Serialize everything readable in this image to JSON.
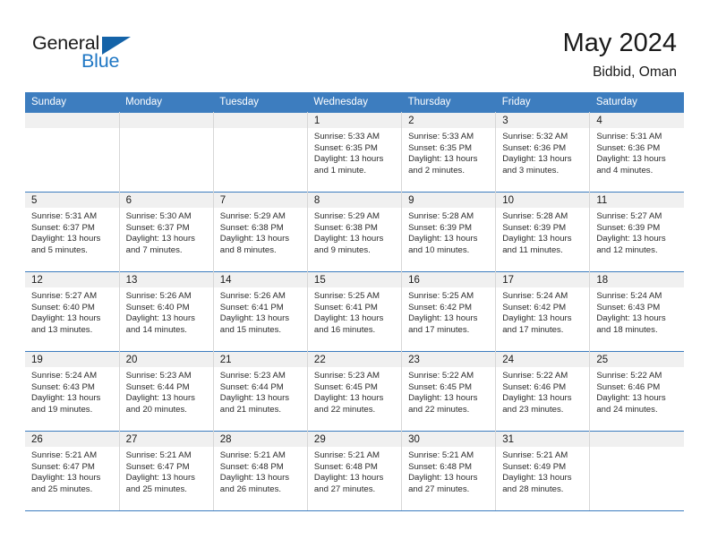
{
  "brand": {
    "name_part1": "General",
    "name_part2": "Blue",
    "accent_color": "#1f77c4",
    "triangle_color": "#1463a8"
  },
  "header": {
    "title": "May 2024",
    "subtitle": "Bidbid, Oman"
  },
  "calendar": {
    "header_bg": "#3d7dbf",
    "daynum_bg": "#f0f0f0",
    "weekdays": [
      "Sunday",
      "Monday",
      "Tuesday",
      "Wednesday",
      "Thursday",
      "Friday",
      "Saturday"
    ],
    "weeks": [
      [
        {
          "day": "",
          "sunrise": "",
          "sunset": "",
          "daylight1": "",
          "daylight2": "",
          "empty": true
        },
        {
          "day": "",
          "sunrise": "",
          "sunset": "",
          "daylight1": "",
          "daylight2": "",
          "empty": true
        },
        {
          "day": "",
          "sunrise": "",
          "sunset": "",
          "daylight1": "",
          "daylight2": "",
          "empty": true
        },
        {
          "day": "1",
          "sunrise": "Sunrise: 5:33 AM",
          "sunset": "Sunset: 6:35 PM",
          "daylight1": "Daylight: 13 hours",
          "daylight2": "and 1 minute."
        },
        {
          "day": "2",
          "sunrise": "Sunrise: 5:33 AM",
          "sunset": "Sunset: 6:35 PM",
          "daylight1": "Daylight: 13 hours",
          "daylight2": "and 2 minutes."
        },
        {
          "day": "3",
          "sunrise": "Sunrise: 5:32 AM",
          "sunset": "Sunset: 6:36 PM",
          "daylight1": "Daylight: 13 hours",
          "daylight2": "and 3 minutes."
        },
        {
          "day": "4",
          "sunrise": "Sunrise: 5:31 AM",
          "sunset": "Sunset: 6:36 PM",
          "daylight1": "Daylight: 13 hours",
          "daylight2": "and 4 minutes."
        }
      ],
      [
        {
          "day": "5",
          "sunrise": "Sunrise: 5:31 AM",
          "sunset": "Sunset: 6:37 PM",
          "daylight1": "Daylight: 13 hours",
          "daylight2": "and 5 minutes."
        },
        {
          "day": "6",
          "sunrise": "Sunrise: 5:30 AM",
          "sunset": "Sunset: 6:37 PM",
          "daylight1": "Daylight: 13 hours",
          "daylight2": "and 7 minutes."
        },
        {
          "day": "7",
          "sunrise": "Sunrise: 5:29 AM",
          "sunset": "Sunset: 6:38 PM",
          "daylight1": "Daylight: 13 hours",
          "daylight2": "and 8 minutes."
        },
        {
          "day": "8",
          "sunrise": "Sunrise: 5:29 AM",
          "sunset": "Sunset: 6:38 PM",
          "daylight1": "Daylight: 13 hours",
          "daylight2": "and 9 minutes."
        },
        {
          "day": "9",
          "sunrise": "Sunrise: 5:28 AM",
          "sunset": "Sunset: 6:39 PM",
          "daylight1": "Daylight: 13 hours",
          "daylight2": "and 10 minutes."
        },
        {
          "day": "10",
          "sunrise": "Sunrise: 5:28 AM",
          "sunset": "Sunset: 6:39 PM",
          "daylight1": "Daylight: 13 hours",
          "daylight2": "and 11 minutes."
        },
        {
          "day": "11",
          "sunrise": "Sunrise: 5:27 AM",
          "sunset": "Sunset: 6:39 PM",
          "daylight1": "Daylight: 13 hours",
          "daylight2": "and 12 minutes."
        }
      ],
      [
        {
          "day": "12",
          "sunrise": "Sunrise: 5:27 AM",
          "sunset": "Sunset: 6:40 PM",
          "daylight1": "Daylight: 13 hours",
          "daylight2": "and 13 minutes."
        },
        {
          "day": "13",
          "sunrise": "Sunrise: 5:26 AM",
          "sunset": "Sunset: 6:40 PM",
          "daylight1": "Daylight: 13 hours",
          "daylight2": "and 14 minutes."
        },
        {
          "day": "14",
          "sunrise": "Sunrise: 5:26 AM",
          "sunset": "Sunset: 6:41 PM",
          "daylight1": "Daylight: 13 hours",
          "daylight2": "and 15 minutes."
        },
        {
          "day": "15",
          "sunrise": "Sunrise: 5:25 AM",
          "sunset": "Sunset: 6:41 PM",
          "daylight1": "Daylight: 13 hours",
          "daylight2": "and 16 minutes."
        },
        {
          "day": "16",
          "sunrise": "Sunrise: 5:25 AM",
          "sunset": "Sunset: 6:42 PM",
          "daylight1": "Daylight: 13 hours",
          "daylight2": "and 17 minutes."
        },
        {
          "day": "17",
          "sunrise": "Sunrise: 5:24 AM",
          "sunset": "Sunset: 6:42 PM",
          "daylight1": "Daylight: 13 hours",
          "daylight2": "and 17 minutes."
        },
        {
          "day": "18",
          "sunrise": "Sunrise: 5:24 AM",
          "sunset": "Sunset: 6:43 PM",
          "daylight1": "Daylight: 13 hours",
          "daylight2": "and 18 minutes."
        }
      ],
      [
        {
          "day": "19",
          "sunrise": "Sunrise: 5:24 AM",
          "sunset": "Sunset: 6:43 PM",
          "daylight1": "Daylight: 13 hours",
          "daylight2": "and 19 minutes."
        },
        {
          "day": "20",
          "sunrise": "Sunrise: 5:23 AM",
          "sunset": "Sunset: 6:44 PM",
          "daylight1": "Daylight: 13 hours",
          "daylight2": "and 20 minutes."
        },
        {
          "day": "21",
          "sunrise": "Sunrise: 5:23 AM",
          "sunset": "Sunset: 6:44 PM",
          "daylight1": "Daylight: 13 hours",
          "daylight2": "and 21 minutes."
        },
        {
          "day": "22",
          "sunrise": "Sunrise: 5:23 AM",
          "sunset": "Sunset: 6:45 PM",
          "daylight1": "Daylight: 13 hours",
          "daylight2": "and 22 minutes."
        },
        {
          "day": "23",
          "sunrise": "Sunrise: 5:22 AM",
          "sunset": "Sunset: 6:45 PM",
          "daylight1": "Daylight: 13 hours",
          "daylight2": "and 22 minutes."
        },
        {
          "day": "24",
          "sunrise": "Sunrise: 5:22 AM",
          "sunset": "Sunset: 6:46 PM",
          "daylight1": "Daylight: 13 hours",
          "daylight2": "and 23 minutes."
        },
        {
          "day": "25",
          "sunrise": "Sunrise: 5:22 AM",
          "sunset": "Sunset: 6:46 PM",
          "daylight1": "Daylight: 13 hours",
          "daylight2": "and 24 minutes."
        }
      ],
      [
        {
          "day": "26",
          "sunrise": "Sunrise: 5:21 AM",
          "sunset": "Sunset: 6:47 PM",
          "daylight1": "Daylight: 13 hours",
          "daylight2": "and 25 minutes."
        },
        {
          "day": "27",
          "sunrise": "Sunrise: 5:21 AM",
          "sunset": "Sunset: 6:47 PM",
          "daylight1": "Daylight: 13 hours",
          "daylight2": "and 25 minutes."
        },
        {
          "day": "28",
          "sunrise": "Sunrise: 5:21 AM",
          "sunset": "Sunset: 6:48 PM",
          "daylight1": "Daylight: 13 hours",
          "daylight2": "and 26 minutes."
        },
        {
          "day": "29",
          "sunrise": "Sunrise: 5:21 AM",
          "sunset": "Sunset: 6:48 PM",
          "daylight1": "Daylight: 13 hours",
          "daylight2": "and 27 minutes."
        },
        {
          "day": "30",
          "sunrise": "Sunrise: 5:21 AM",
          "sunset": "Sunset: 6:48 PM",
          "daylight1": "Daylight: 13 hours",
          "daylight2": "and 27 minutes."
        },
        {
          "day": "31",
          "sunrise": "Sunrise: 5:21 AM",
          "sunset": "Sunset: 6:49 PM",
          "daylight1": "Daylight: 13 hours",
          "daylight2": "and 28 minutes."
        },
        {
          "day": "",
          "sunrise": "",
          "sunset": "",
          "daylight1": "",
          "daylight2": "",
          "empty": true
        }
      ]
    ]
  }
}
